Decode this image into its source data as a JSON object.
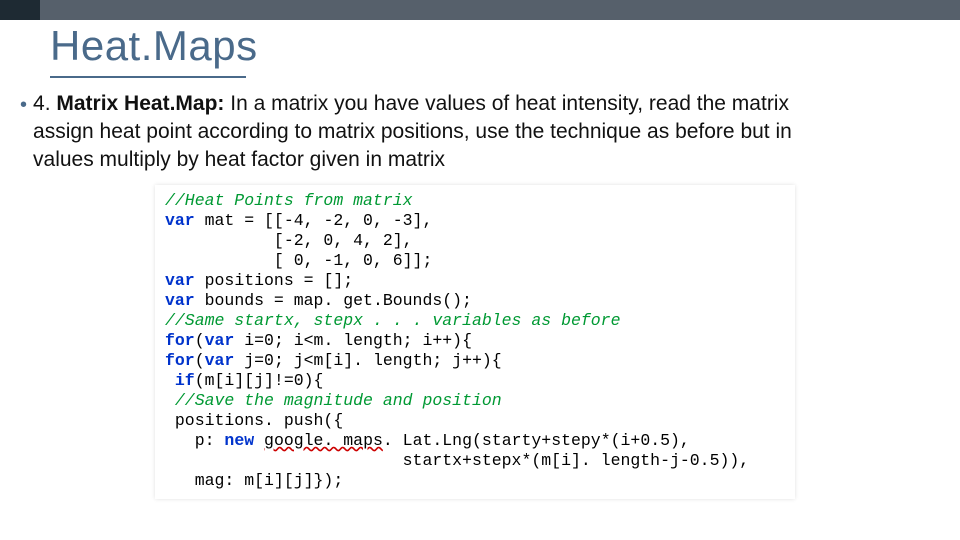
{
  "title": "Heat.Maps",
  "bullet": {
    "number": "4.",
    "bold": "Matrix Heat.Map:",
    "rest_line1": " In a matrix you have values of heat intensity, read the matrix",
    "line2": "assign heat point according to matrix positions, use the technique as before but in",
    "line3": "values multiply by heat factor given in matrix"
  },
  "code": {
    "l01_comment": "//Heat Points from matrix",
    "l02_a": "var",
    "l02_b": " mat = [[-4, -2, 0, -3],",
    "l03": "           [-2, 0, 4, 2],",
    "l04": "           [ 0, -1, 0, 6]];",
    "l05_a": "var",
    "l05_b": " positions = [];",
    "l06_a": "var",
    "l06_b": " bounds = map. get.Bounds();",
    "l07_comment": "//Same startx, stepx . . . variables as before",
    "l08_a": "for",
    "l08_b": "(",
    "l08_c": "var",
    "l08_d": " i=0; i<m. length; i++){",
    "l09_a": "for",
    "l09_b": "(",
    "l09_c": "var",
    "l09_d": " j=0; j<m[i]. length; j++){",
    "l10_a": " ",
    "l10_b": "if",
    "l10_c": "(m[i][j]!=0){",
    "l11_comment": " //Save the magnitude and position",
    "l12": " positions. push({",
    "l13_a": "   p: ",
    "l13_b": "new",
    "l13_c": " ",
    "l13_under": "google. maps",
    "l13_d": ". Lat.Lng(starty+stepy*(i+0.5),",
    "l14": "                        startx+stepx*(m[i]. length-j-0.5)),",
    "l15": "   mag: m[i][j]});"
  }
}
